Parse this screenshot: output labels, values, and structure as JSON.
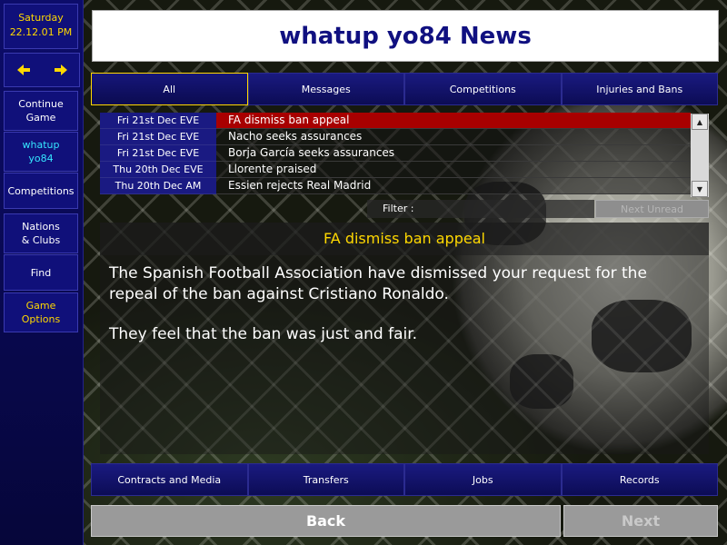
{
  "sidebar": {
    "date": {
      "day": "Saturday",
      "datetime": "22.12.01 PM"
    },
    "items": [
      {
        "label": "Continue Game"
      },
      {
        "label": "whatup yo84"
      },
      {
        "label": "Competitions"
      },
      {
        "label": "Nations & Clubs"
      },
      {
        "label": "Find"
      },
      {
        "label": "Game Options"
      }
    ]
  },
  "title": "whatup yo84 News",
  "tabs": [
    "All",
    "Messages",
    "Competitions",
    "Injuries and Bans"
  ],
  "news_list": [
    {
      "date": "Fri 21st Dec EVE",
      "headline": "FA dismiss ban appeal",
      "selected": true
    },
    {
      "date": "Fri 21st Dec EVE",
      "headline": "Nacho seeks assurances",
      "selected": false
    },
    {
      "date": "Fri 21st Dec EVE",
      "headline": "Borja García seeks assurances",
      "selected": false
    },
    {
      "date": "Thu 20th Dec EVE",
      "headline": "Llorente praised",
      "selected": false
    },
    {
      "date": "Thu 20th Dec AM",
      "headline": "Essien rejects Real Madrid",
      "selected": false
    }
  ],
  "filter": {
    "label": "Filter :",
    "next_unread": "Next Unread"
  },
  "article": {
    "title": "FA dismiss ban appeal",
    "paragraphs": [
      "The Spanish Football Association have dismissed your request for the repeal of the ban against Cristiano Ronaldo.",
      "They feel that the ban was just and fair."
    ]
  },
  "bottom_tabs": [
    "Contracts and Media",
    "Transfers",
    "Jobs",
    "Records"
  ],
  "nav": {
    "back": "Back",
    "next": "Next"
  },
  "colors": {
    "accent_yellow": "#ffd800",
    "sidebar_blue": "#10107a",
    "selected_row": "#a80000",
    "title_text": "#101080"
  }
}
